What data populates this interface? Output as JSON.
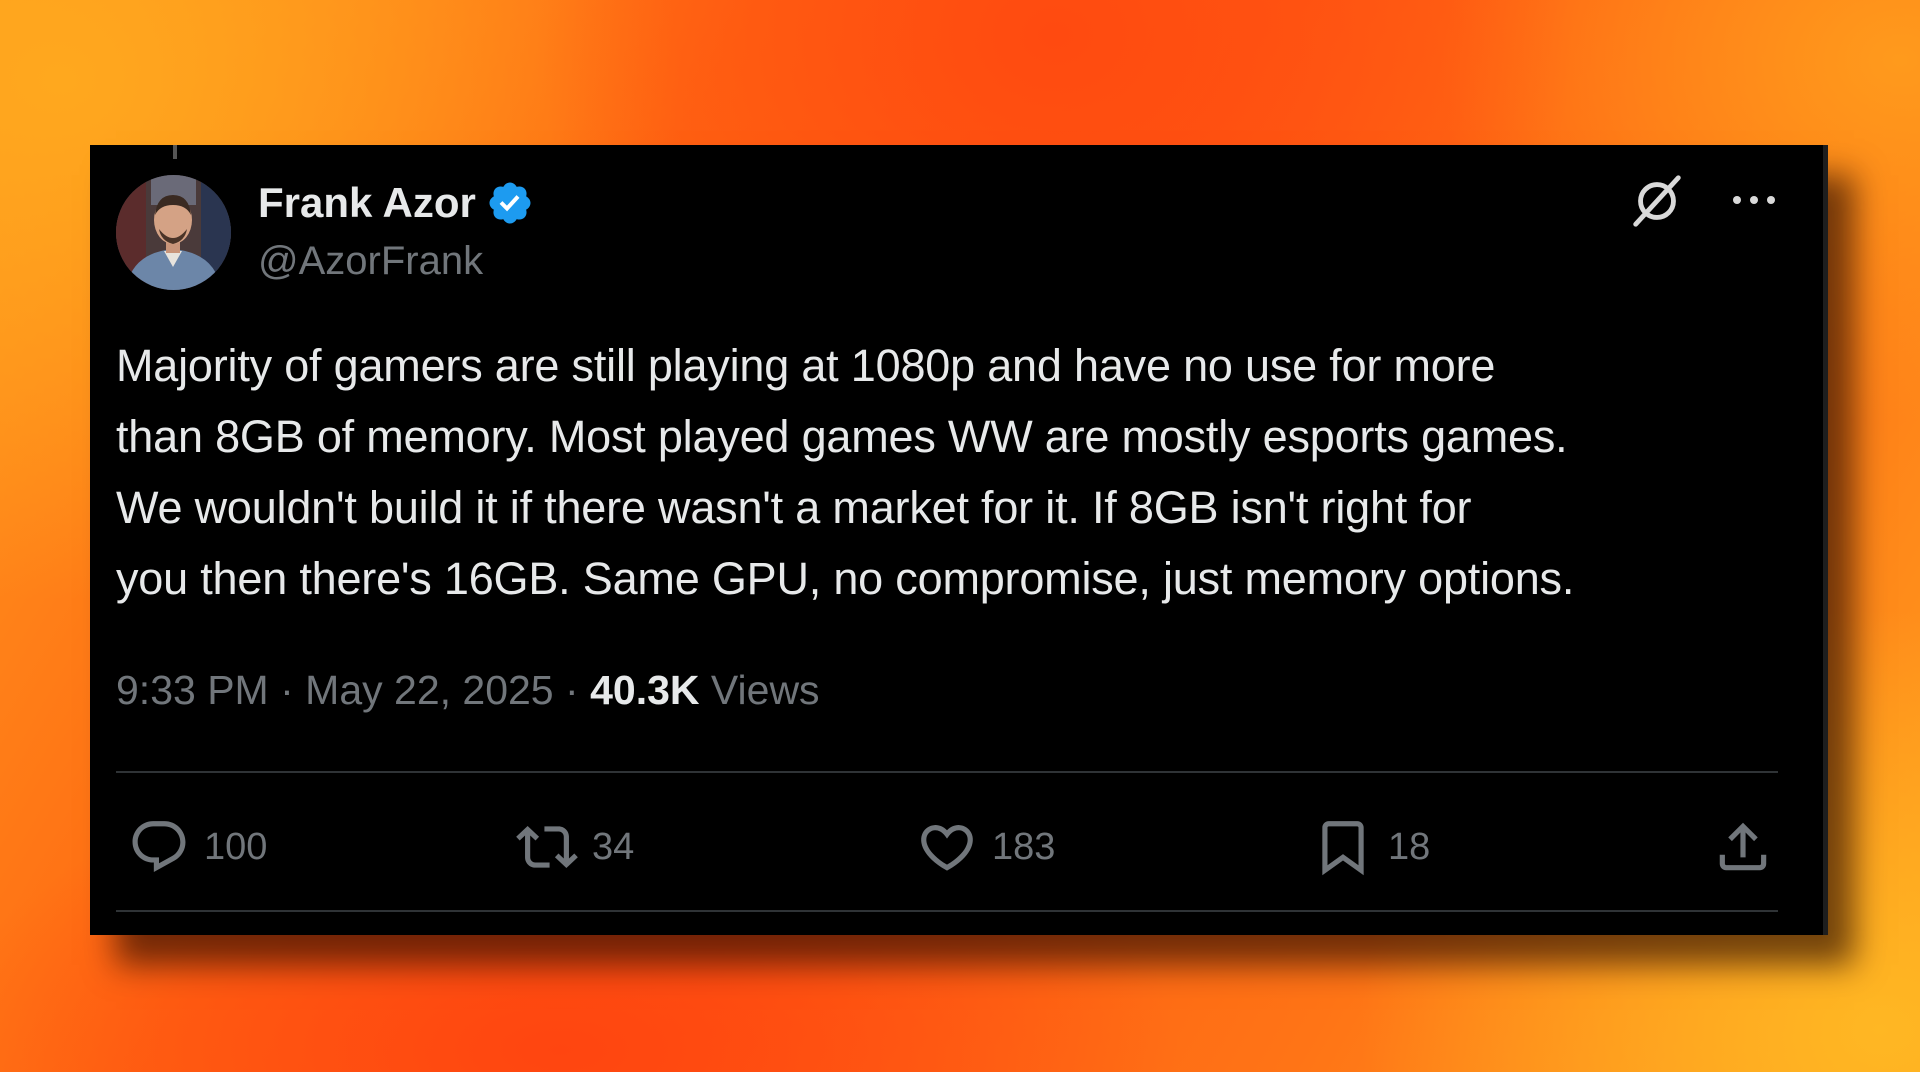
{
  "tweet": {
    "author": {
      "display_name": "Frank Azor",
      "handle": "@AzorFrank",
      "verified": true,
      "verified_color": "#1d9bf0"
    },
    "text_lines": [
      "Majority of gamers are still playing at 1080p and have no use for more",
      "than 8GB of memory. Most played games WW are mostly esports games.",
      "We wouldn't build it if there wasn't a market for it. If 8GB isn't right for",
      "you then there's 16GB. Same GPU, no compromise, just memory options."
    ],
    "time": "9:33 PM",
    "date": "May 22, 2025",
    "separator": "·",
    "views_count": "40.3K",
    "views_label": "Views",
    "actions": {
      "reply": {
        "icon": "reply-icon",
        "count": "100"
      },
      "repost": {
        "icon": "repost-icon",
        "count": "34"
      },
      "like": {
        "icon": "heart-icon",
        "count": "183"
      },
      "bookmark": {
        "icon": "bookmark-icon",
        "count": "18"
      },
      "share": {
        "icon": "share-icon"
      }
    }
  },
  "colors": {
    "card_background": "#000000",
    "primary_text": "#e7e9ea",
    "secondary_text": "#71767b",
    "backdrop_orange": "#ff5a12",
    "backdrop_yellow": "#ffa81e"
  }
}
